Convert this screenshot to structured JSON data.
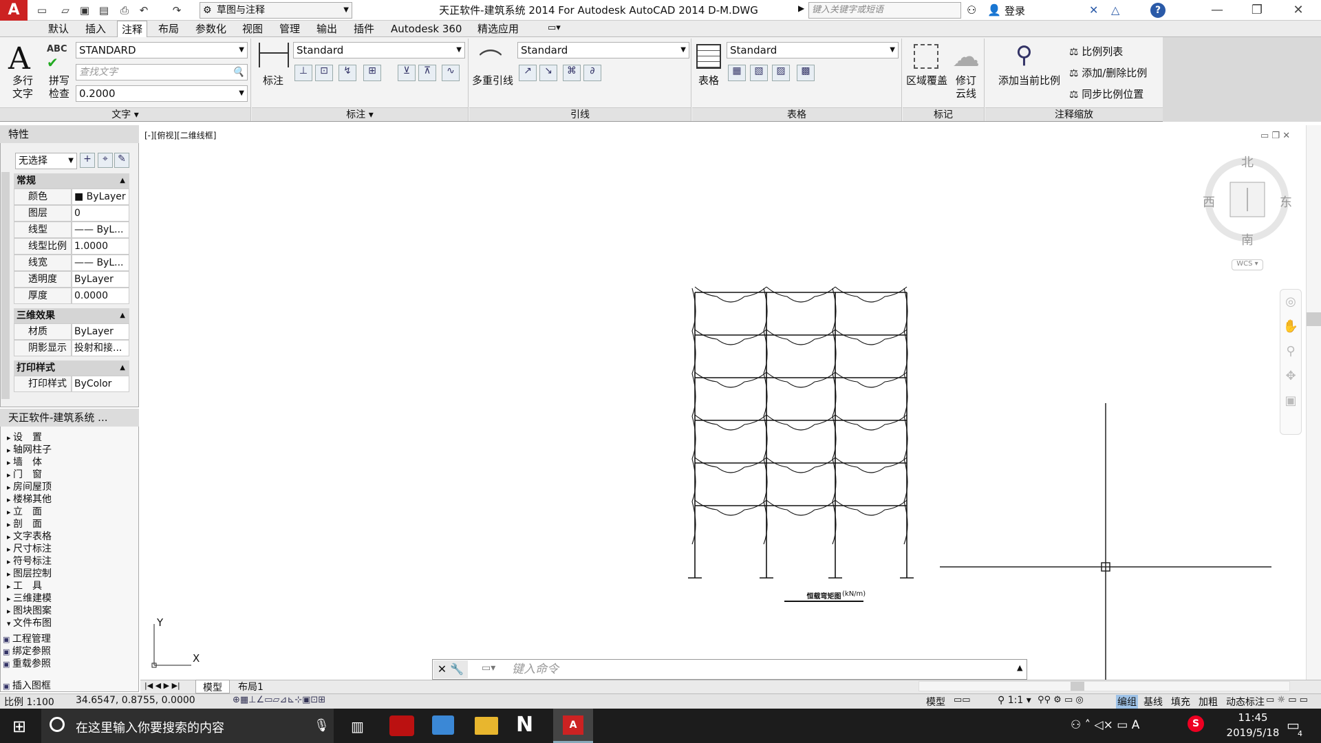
{
  "titlebar": {
    "workspace": "草图与注释",
    "title": "天正软件-建筑系统 2014  For Autodesk AutoCAD 2014    D-M.DWG",
    "search_placeholder": "键入关键字或短语",
    "login": "登录"
  },
  "ribbon_tabs": [
    "默认",
    "插入",
    "注释",
    "布局",
    "参数化",
    "视图",
    "管理",
    "输出",
    "插件",
    "Autodesk 360",
    "精选应用"
  ],
  "ribbon": {
    "text": {
      "multiline_l1": "多行",
      "multiline_l2": "文字",
      "spell_l1": "拼写",
      "spell_l2": "检查",
      "style": "STANDARD",
      "find_placeholder": "查找文字",
      "height": "0.2000",
      "title": "文字"
    },
    "dim": {
      "label": "标注",
      "style": "Standard",
      "title": "标注"
    },
    "leader": {
      "label": "多重引线",
      "style": "Standard",
      "title": "引线"
    },
    "table": {
      "label": "表格",
      "style": "Standard",
      "title": "表格"
    },
    "mark": {
      "wipeout": "区域覆盖",
      "revcloud_l1": "修订",
      "revcloud_l2": "云线",
      "title": "标记"
    },
    "scale": {
      "add_l1": "添加当前比例",
      "list": "比例列表",
      "add_remove": "添加/删除比例",
      "sync": "同步比例位置",
      "title": "注释缩放"
    }
  },
  "properties": {
    "title": "特性",
    "selection": "无选择",
    "sections": {
      "general": "常规",
      "effects": "三维效果",
      "plot": "打印样式"
    },
    "rows": [
      {
        "k": "颜色",
        "v": "■ ByLayer"
      },
      {
        "k": "图层",
        "v": "0"
      },
      {
        "k": "线型",
        "v": "—— ByL..."
      },
      {
        "k": "线型比例",
        "v": "1.0000"
      },
      {
        "k": "线宽",
        "v": "—— ByL..."
      },
      {
        "k": "透明度",
        "v": "ByLayer"
      },
      {
        "k": "厚度",
        "v": "0.0000"
      }
    ],
    "rows3d": [
      {
        "k": "材质",
        "v": "ByLayer"
      },
      {
        "k": "阴影显示",
        "v": "投射和接..."
      }
    ],
    "rowsplot": [
      {
        "k": "打印样式",
        "v": "ByColor"
      }
    ]
  },
  "tz": {
    "title": "天正软件-建筑系统 ...",
    "items": [
      "设　置",
      "轴网柱子",
      "墙　体",
      "门　窗",
      "房间屋顶",
      "楼梯其他",
      "立　面",
      "剖　面",
      "文字表格",
      "尺寸标注",
      "符号标注",
      "图层控制",
      "工　具",
      "三维建模",
      "图块图案",
      "文件布图"
    ],
    "sub": [
      "工程管理",
      "绑定参照",
      "重载参照",
      "插入图框"
    ]
  },
  "viewport": {
    "label": "[-][俯视][二维线框]",
    "compass": {
      "n": "北",
      "s": "南",
      "w": "西",
      "e": "东",
      "wcs": "WCS"
    },
    "drawing_title": "恒载弯矩图",
    "drawing_unit": "(kN/m)",
    "ucs_y": "Y",
    "ucs_x": "X"
  },
  "cmd": {
    "placeholder": "键入命令"
  },
  "layout_tabs": [
    "模型",
    "布局1"
  ],
  "status": {
    "scale": "比例 1:100",
    "coords": "34.6547, 0.8755, 0.0000",
    "model": "模型",
    "anno": "1:1",
    "right": [
      "编组",
      "基线",
      "填充",
      "加粗",
      "动态标注"
    ]
  },
  "taskbar": {
    "search": "在这里输入你要搜索的内容",
    "time": "11:45",
    "date": "2019/5/18",
    "badge": "4"
  }
}
